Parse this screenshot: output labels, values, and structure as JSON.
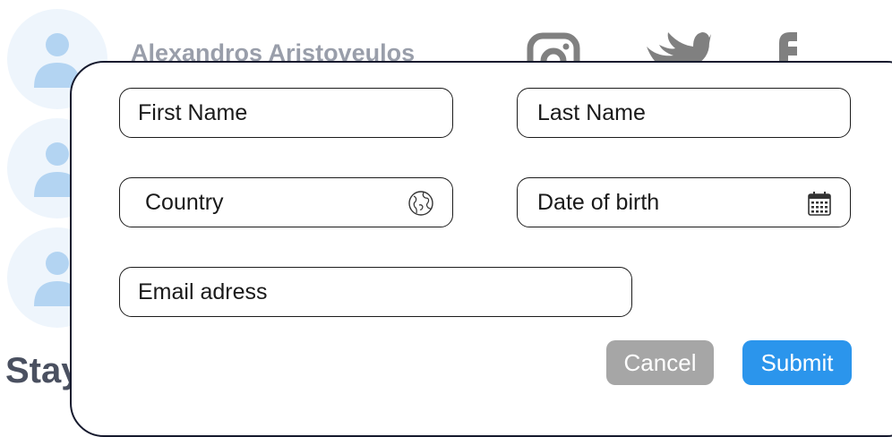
{
  "background": {
    "person_name": "Alexandros Aristoveulos",
    "heading_fragment": "Stay"
  },
  "form": {
    "first_name": {
      "placeholder": "First Name"
    },
    "last_name": {
      "placeholder": "Last Name"
    },
    "country": {
      "placeholder": "Country",
      "icon": "globe-icon"
    },
    "date_of_birth": {
      "placeholder": "Date of birth",
      "icon": "calendar-icon"
    },
    "email": {
      "placeholder": "Email adress"
    }
  },
  "buttons": {
    "cancel": "Cancel",
    "submit": "Submit"
  },
  "colors": {
    "accent": "#2b95ec",
    "cancel": "#a6a6a6",
    "modal_border": "#161a2e",
    "avatar_icon": "#b3d4f2",
    "avatar_bg": "#eef5fc"
  }
}
